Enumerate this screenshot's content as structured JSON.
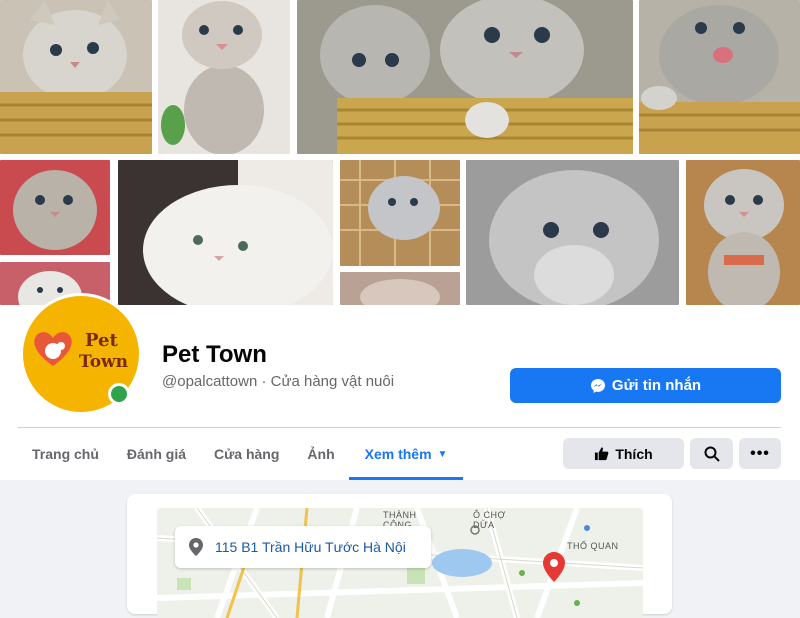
{
  "page": {
    "name": "Pet Town",
    "handle_category": "@opalcattown · Cửa hàng vật nuôi",
    "avatar_text_line1": "Pet",
    "avatar_text_line2": "Town"
  },
  "actions": {
    "message_label": "Gửi tin nhắn",
    "like_label": "Thích"
  },
  "tabs": [
    {
      "label": "Trang chủ"
    },
    {
      "label": "Đánh giá"
    },
    {
      "label": "Cửa hàng"
    },
    {
      "label": "Ảnh"
    },
    {
      "label": "Xem thêm",
      "active": true
    }
  ],
  "about": {
    "address": "115 B1 Trần Hữu Tước Hà Nội",
    "map_labels": [
      "THÀNH CÔNG",
      "Ô CHỢ DỪA",
      "THỔ QUAN"
    ]
  },
  "colors": {
    "primary": "#1877f2",
    "online": "#31a24c",
    "avatar_bg": "#f5b400",
    "map_pin": "#e53935"
  }
}
